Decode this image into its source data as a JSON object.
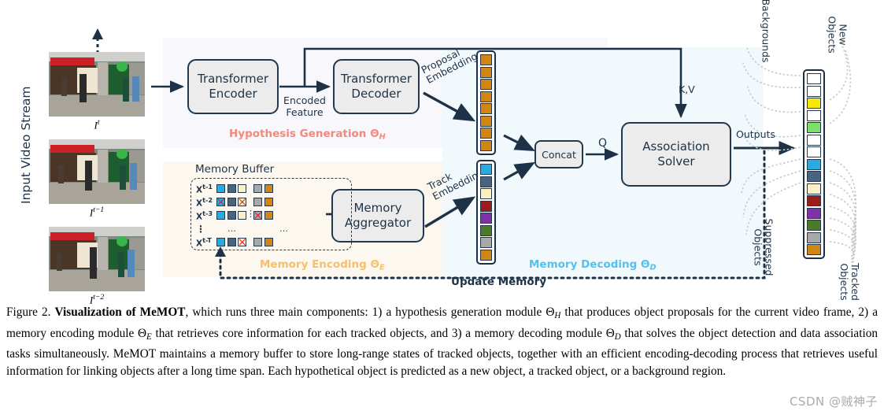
{
  "figure": {
    "panels": [
      {
        "id": "hypothesis",
        "label": "Hypothesis Generation Θ",
        "sub": "H",
        "color": "#f4887a",
        "bg": "#f7f7fc"
      },
      {
        "id": "encoding",
        "label": "Memory Encoding Θ",
        "sub": "E",
        "color": "#f6bf6b",
        "bg": "#fdf8ef"
      },
      {
        "id": "decoding",
        "label": "Memory Decoding Θ",
        "sub": "D",
        "color": "#55c0ee",
        "bg": "#f2f9fd"
      }
    ],
    "boxes": {
      "transformer_encoder": "Transformer\nEncoder",
      "transformer_decoder": "Transformer\nDecoder",
      "memory_aggregator": "Memory\nAggregator",
      "association_solver": "Association\nSolver",
      "concat": "Concat"
    },
    "labels": {
      "input_video_stream": "Input Video Stream",
      "encoded_feature": "Encoded Feature",
      "proposal_embeddings_l1": "Proposal",
      "proposal_embeddings_l2": "Embeddings",
      "track_embeddings_l1": "Track",
      "track_embeddings_l2": "Embeddings",
      "memory_buffer": "Memory Buffer",
      "kv": "K,V",
      "q": "Q",
      "outputs": "Outputs",
      "update_memory": "Update Memory",
      "backgrounds": "Backgrounds",
      "new_objects": "New\nObjects",
      "suppressed_objects": "Suppressed\nObjects",
      "tracked_objects": "Tracked\nObjects"
    },
    "frames": [
      {
        "caption": "I",
        "sup": "t"
      },
      {
        "caption": "I",
        "sup": "t−1"
      },
      {
        "caption": "I",
        "sup": "t−2"
      }
    ],
    "memory_buffer_rows": [
      {
        "label": "X",
        "sup": "t-1",
        "left": [
          "cyan",
          "slate",
          "cream"
        ],
        "right": [
          "gray",
          "orange"
        ],
        "x_left": [],
        "x_right": []
      },
      {
        "label": "X",
        "sup": "t-2",
        "left": [
          "cyan",
          "slate",
          "cream"
        ],
        "right": [
          "gray",
          "orange"
        ],
        "x_left": [
          0,
          2
        ],
        "x_right": []
      },
      {
        "label": "X",
        "sup": "t-3",
        "left": [
          "cyan",
          "slate",
          "cream"
        ],
        "right": [
          "gray",
          "orange"
        ],
        "x_left": [],
        "x_right": [
          0
        ]
      },
      {
        "label": "",
        "sup": "",
        "dots": true
      },
      {
        "label": "X",
        "sup": "t-T",
        "left": [
          "cyan",
          "slate",
          "cream"
        ],
        "right": [
          "gray",
          "orange"
        ],
        "x_left": [
          2
        ],
        "x_right": []
      }
    ],
    "proposal_embedding_cells": [
      "orange",
      "orange",
      "orange",
      "orange",
      "orange",
      "orange",
      "orange",
      "orange"
    ],
    "track_embedding_cells": [
      "cyan",
      "slate",
      "cream",
      "darkred",
      "purple",
      "green",
      "gray",
      "orange"
    ],
    "output_cells": [
      "white",
      "white",
      "yellow",
      "white",
      "lightgreen",
      "white",
      "white",
      "cyan",
      "slate",
      "cream",
      "darkred",
      "purple",
      "green",
      "gray",
      "orange"
    ],
    "palette": {
      "cyan": "#29abe2",
      "slate": "#4a6480",
      "cream": "#fbf0c4",
      "darkred": "#9e1b1b",
      "purple": "#8031a7",
      "green": "#4a7a2a",
      "gray": "#a8a8a8",
      "orange": "#d18512",
      "yellow": "#f5ea00",
      "lightgreen": "#7ae06a",
      "white": "#ffffff",
      "stroke": "#22384f",
      "arrow": "#1d3247"
    }
  },
  "caption": {
    "prefix": "Figure 2. ",
    "bold": "Visualization of MeMOT",
    "part1": ", which runs three main components: 1) a hypothesis generation module Θ",
    "sub1": "H",
    "part2": " that produces object proposals for the current video frame, 2) a memory encoding module Θ",
    "sub2": "E",
    "part3": " that retrieves core information for each tracked objects, and 3) a memory decoding module Θ",
    "sub3": "D",
    "part4": " that solves the object detection and data association tasks simultaneously. MeMOT maintains a memory buffer to store long-range states of tracked objects, together with an efficient encoding-decoding process that retrieves useful information for linking objects after a long time span. Each hypothetical object is predicted as a new object, a tracked object, or a background region."
  },
  "watermark": {
    "text": "CSDN @贼神子"
  }
}
